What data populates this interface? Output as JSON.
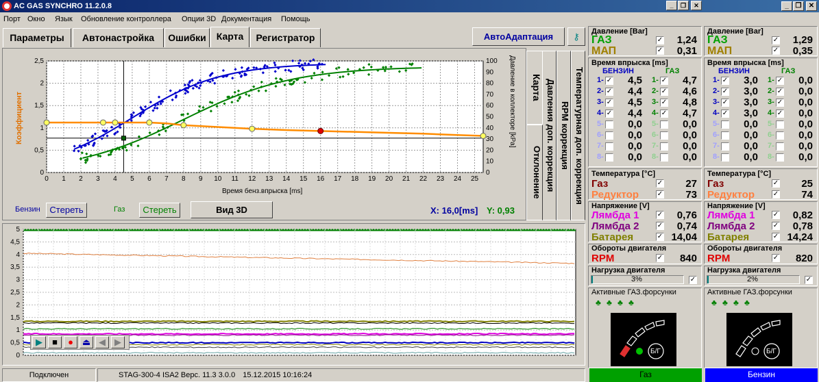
{
  "app": {
    "title": "AC GAS SYNCHRO  11.2.0.8"
  },
  "menu": [
    "Порт",
    "Окно",
    "Язык",
    "Обновление контроллера",
    "Опции 3D",
    "Документация",
    "Помощь"
  ],
  "tabs": [
    "Параметры",
    "Автонастройка",
    "Ошибки",
    "Карта",
    "Регистратор"
  ],
  "autoadapt": "АвтоАдаптация",
  "vtabs": [
    "Карта",
    "Давления доп. коррекция",
    "RPM коррекция",
    "Температурная доп. коррекция",
    "Отклонение"
  ],
  "map": {
    "ylabel_left": "Коэффициент",
    "ylabel_right": "Давление в коллекторе [kPa]",
    "xlabel": "Время бенз.впрыска [ms]",
    "benz_label": "Бензин",
    "benz_clear": "Стереть",
    "gas_label": "Газ",
    "gas_clear": "Стереть",
    "view3d": "Вид 3D",
    "x_readout": "X: 16,0[ms]",
    "y_readout": "Y: 0,93",
    "x_ticks": [
      "0",
      "1",
      "2",
      "3",
      "4",
      "5",
      "6",
      "7",
      "8",
      "9",
      "10",
      "11",
      "12",
      "13",
      "14",
      "15",
      "16",
      "17",
      "18",
      "19",
      "20",
      "21",
      "22",
      "23",
      "24",
      "25"
    ],
    "y_ticks": [
      "0",
      "0,5",
      "1",
      "1,5",
      "2",
      "2,5"
    ],
    "r_ticks": [
      "0",
      "10",
      "20",
      "30",
      "40",
      "50",
      "60",
      "70",
      "80",
      "90",
      "100"
    ]
  },
  "chart_data": [
    {
      "type": "scatter",
      "xlabel": "Время бенз.впрыска [ms]",
      "ylabel": "Коэффициент",
      "xlim": [
        0,
        25.5
      ],
      "ylim": [
        0,
        2.5
      ],
      "series": [
        {
          "name": "Бензин",
          "color": "#0000cc"
        },
        {
          "name": "Газ",
          "color": "#008000"
        }
      ],
      "coef_curve": {
        "color": "#ff8c00",
        "x": [
          0,
          1,
          2,
          3,
          4,
          5,
          6,
          7,
          8,
          10,
          12,
          14,
          16,
          18,
          20,
          22,
          24,
          25.5
        ],
        "y": [
          1.12,
          1.12,
          1.12,
          1.12,
          1.12,
          1.12,
          1.12,
          1.1,
          1.06,
          1.02,
          0.98,
          0.95,
          0.93,
          0.91,
          0.89,
          0.87,
          0.84,
          0.82
        ]
      },
      "y2lim": [
        0,
        100
      ]
    },
    {
      "type": "line",
      "ylim": [
        0,
        5
      ],
      "y_ticks": [
        "0",
        "0,5",
        "1",
        "1,5",
        "2",
        "2,5",
        "3",
        "3,5",
        "4",
        "4,5",
        "5"
      ]
    }
  ],
  "panels": [
    {
      "pressure_title": "Давление [Bar]",
      "gas_label": "ГАЗ",
      "gas_val": "1,24",
      "map_label": "МАП",
      "map_val": "0,31",
      "inj_title": "Время впрыска [ms]",
      "benz_head": "БЕНЗИН",
      "gas_head": "ГАЗ",
      "benz": [
        "4,5",
        "4,4",
        "4,5",
        "4,4",
        "0,0",
        "0,0",
        "0,0",
        "0,0"
      ],
      "gas": [
        "4,7",
        "4,6",
        "4,8",
        "4,7",
        "0,0",
        "0,0",
        "0,0",
        "0,0"
      ],
      "temp_title": "Температура  [°C]",
      "t_gas_label": "Газ",
      "t_gas": "27",
      "t_red_label": "Редуктор",
      "t_red": "73",
      "volt_title": "Напряжение [V]",
      "l1": "Лямбда 1",
      "l1v": "0,76",
      "l2": "Лямбда 2",
      "l2v": "0,74",
      "bat": "Батарея",
      "batv": "14,04",
      "rpm_title": "Обороты двигателя",
      "rpm": "RPM",
      "rpmv": "840",
      "load_title": "Нагрузка двигателя",
      "load": "3%",
      "active_title": "Активные ГАЗ.форсунки",
      "bg": "Б/Г",
      "footer": "Газ"
    },
    {
      "pressure_title": "Давление [Bar]",
      "gas_label": "ГАЗ",
      "gas_val": "1,29",
      "map_label": "МАП",
      "map_val": "0,35",
      "inj_title": "Время впрыска [ms]",
      "benz_head": "БЕНЗИН",
      "gas_head": "ГАЗ",
      "benz": [
        "3,0",
        "3,0",
        "3,0",
        "3,0",
        "0,0",
        "0,0",
        "0,0",
        "0,0"
      ],
      "gas": [
        "0,0",
        "0,0",
        "0,0",
        "0,0",
        "0,0",
        "0,0",
        "0,0",
        "0,0"
      ],
      "temp_title": "Температура  [°C]",
      "t_gas_label": "Газ",
      "t_gas": "25",
      "t_red_label": "Редуктор",
      "t_red": "74",
      "volt_title": "Напряжение [V]",
      "l1": "Лямбда 1",
      "l1v": "0,82",
      "l2": "Лямбда 2",
      "l2v": "0,78",
      "bat": "Батарея",
      "batv": "14,24",
      "rpm_title": "Обороты двигателя",
      "rpm": "RPM",
      "rpmv": "820",
      "load_title": "Нагрузка двигателя",
      "load": "2%",
      "active_title": "Активные ГАЗ.форсунки",
      "bg": "Б/Г",
      "footer": "Бензин"
    }
  ],
  "status": {
    "conn": "Подключен",
    "dev": "STAG-300-4 ISA2  Верс. 11.3  3.0.0",
    "date": "15.12.2015 10:16:24"
  }
}
